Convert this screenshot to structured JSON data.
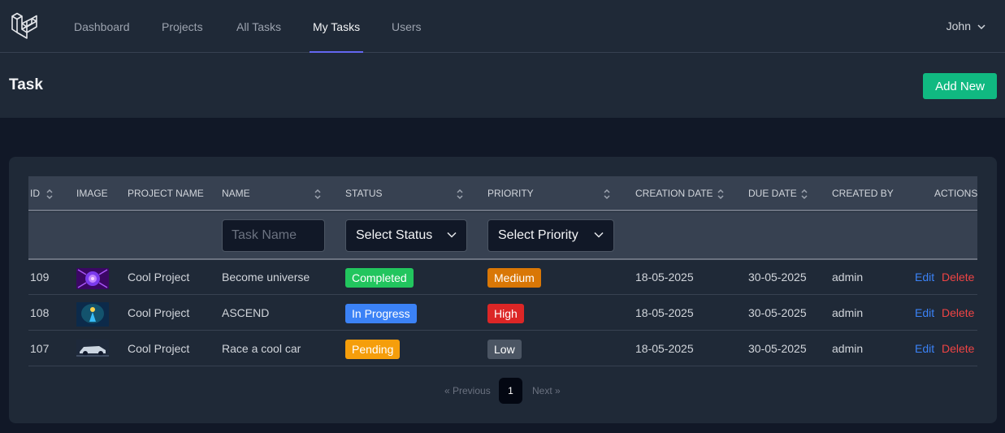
{
  "nav": {
    "links": [
      {
        "label": "Dashboard"
      },
      {
        "label": "Projects"
      },
      {
        "label": "All Tasks"
      },
      {
        "label": "My Tasks",
        "active": true
      },
      {
        "label": "Users"
      }
    ],
    "user_name": "John"
  },
  "header": {
    "title": "Task",
    "add_label": "Add New"
  },
  "table": {
    "columns": [
      "ID",
      "Image",
      "Project Name",
      "Name",
      "Status",
      "Priority",
      "Creation Date",
      "Due Date",
      "Created By",
      "Actions"
    ],
    "filters": {
      "name_placeholder": "Task Name",
      "status_value": "Select Status",
      "priority_value": "Select Priority"
    },
    "rows": [
      {
        "id": "109",
        "image": "purple-abstract-thumbnail",
        "project": "Cool Project",
        "name": "Become universe",
        "status": "Completed",
        "priority": "Medium",
        "created": "18-05-2025",
        "due": "30-05-2025",
        "by": "admin",
        "edit": "Edit",
        "delete": "Delete"
      },
      {
        "id": "108",
        "image": "blue-figure-thumbnail",
        "project": "Cool Project",
        "name": "ASCEND",
        "status": "In Progress",
        "priority": "High",
        "created": "18-05-2025",
        "due": "30-05-2025",
        "by": "admin",
        "edit": "Edit",
        "delete": "Delete"
      },
      {
        "id": "107",
        "image": "car-thumbnail",
        "project": "Cool Project",
        "name": "Race a cool car",
        "status": "Pending",
        "priority": "Low",
        "created": "18-05-2025",
        "due": "30-05-2025",
        "by": "admin",
        "edit": "Edit",
        "delete": "Delete"
      }
    ]
  },
  "pagination": {
    "prev": "« Previous",
    "current": "1",
    "next": "Next »"
  },
  "colors": {
    "accent": "#6366f1",
    "add_button": "#10b981",
    "completed": "#22c55e",
    "in_progress": "#3b82f6",
    "pending": "#f59e0b",
    "high": "#dc2626",
    "medium": "#d97706",
    "low": "#4b5563"
  }
}
